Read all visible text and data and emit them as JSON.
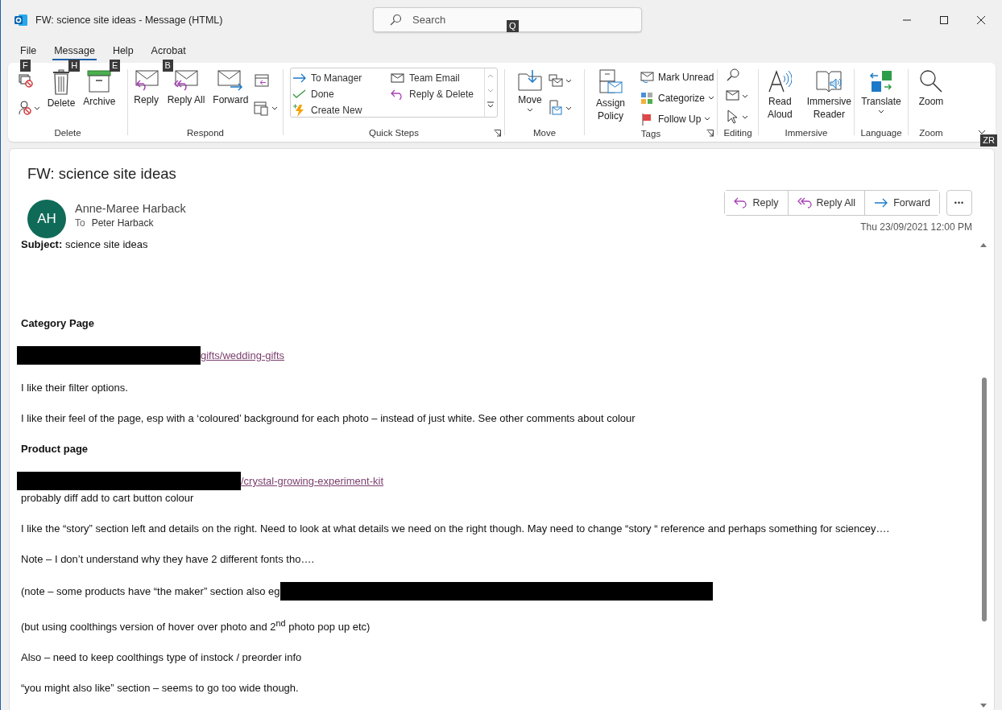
{
  "window": {
    "title": "FW: science site ideas  -  Message (HTML)"
  },
  "search": {
    "placeholder": "Search",
    "keytip": "Q"
  },
  "tabs": [
    {
      "label": "File",
      "keytip": "F",
      "selected": false
    },
    {
      "label": "Message",
      "keytip": "H",
      "selected": true
    },
    {
      "label": "Help",
      "keytip": "E",
      "selected": false
    },
    {
      "label": "Acrobat",
      "keytip": "B",
      "selected": false
    }
  ],
  "ribbon": {
    "keytip": "ZR",
    "groups": [
      {
        "label": "Delete",
        "items": [
          {
            "label": "Delete"
          },
          {
            "label": "Archive"
          }
        ]
      },
      {
        "label": "Respond",
        "items": [
          {
            "label": "Reply"
          },
          {
            "label": "Reply All"
          },
          {
            "label": "Forward"
          }
        ]
      },
      {
        "label": "Quick Steps",
        "items": [
          {
            "label": "To Manager"
          },
          {
            "label": "Team Email"
          },
          {
            "label": "Done"
          },
          {
            "label": "Reply & Delete"
          },
          {
            "label": "Create New"
          }
        ]
      },
      {
        "label": "Move",
        "items": [
          {
            "label": "Move"
          }
        ]
      },
      {
        "label": "Tags",
        "items": [
          {
            "label": "Assign Policy"
          },
          {
            "label": "Mark Unread"
          },
          {
            "label": "Categorize"
          },
          {
            "label": "Follow Up"
          }
        ]
      },
      {
        "label": "Editing"
      },
      {
        "label": "Immersive",
        "items": [
          {
            "label": "Read Aloud"
          },
          {
            "label": "Immersive Reader"
          }
        ]
      },
      {
        "label": "Language",
        "items": [
          {
            "label": "Translate"
          }
        ]
      },
      {
        "label": "Zoom",
        "items": [
          {
            "label": "Zoom"
          }
        ]
      }
    ]
  },
  "message": {
    "subject": "FW: science site ideas",
    "initials": "AH",
    "sender": "Anne-Maree Harback",
    "to_label": "To",
    "to": "Peter Harback",
    "actions": [
      {
        "label": "Reply"
      },
      {
        "label": "Reply All"
      },
      {
        "label": "Forward"
      }
    ],
    "more": "•••",
    "date": "Thu 23/09/2021 12:00 PM",
    "subject_line": "**Subject:** science site ideas",
    "paragraphs": [
      {
        "kind": "heading",
        "text": "Category Page"
      },
      {
        "kind": "link",
        "redacted": true,
        "text": "gifts/wedding-gifts"
      },
      {
        "kind": "text",
        "text": "I like their filter options."
      },
      {
        "kind": "text",
        "text": "I like their feel of the page, esp with a ‘coloured’ background for each photo – instead of just white.  See other comments about colour"
      },
      {
        "kind": "heading",
        "text": "Product page"
      },
      {
        "kind": "link",
        "redacted": true,
        "text": "/crystal-growing-experiment-kit",
        "note": "probably diff add to cart button colour"
      },
      {
        "kind": "text",
        "text": "I like the “story” section left and details on the right.  Need to look at what details we need on the right though.  May need to change “story “ reference and perhaps something for sciencey…."
      },
      {
        "kind": "text",
        "text": "Note – I don’t understand why they have 2 different fonts tho…."
      },
      {
        "kind": "text",
        "redacted": true,
        "text": "(note – some products have “the maker” section also  eg"
      },
      {
        "kind": "text",
        "text": "(but using coolthings version of hover over photo and 2$^{nd}$ photo pop up etc)"
      },
      {
        "kind": "text",
        "text": "Also – need to keep coolthings type of instock / preorder info"
      },
      {
        "kind": "text",
        "text": "“you might also like” section – seems to go too wide though."
      }
    ]
  }
}
